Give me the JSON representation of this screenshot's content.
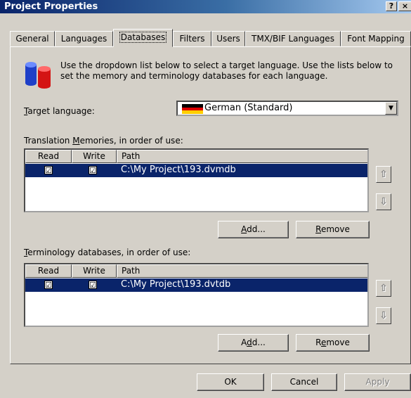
{
  "window": {
    "title": "Project Properties",
    "help_label": "?",
    "close_label": "×"
  },
  "tabs": [
    {
      "label": "General"
    },
    {
      "label": "Languages"
    },
    {
      "label": "Databases",
      "active": true
    },
    {
      "label": "Filters"
    },
    {
      "label": "Users"
    },
    {
      "label": "TMX/BIF Languages"
    },
    {
      "label": "Font Mapping"
    }
  ],
  "intro": "Use the dropdown list below to select a target language. Use the lists below to set the memory and terminology databases for each language.",
  "target_language": {
    "label_first": "T",
    "label_rest": "arget language:",
    "value": "German (Standard)",
    "flag_colors": [
      "#000000",
      "#dd0000",
      "#ffce00"
    ]
  },
  "tm": {
    "label_pre": "Translation ",
    "label_mnemonic": "M",
    "label_post": "emories, in order of use:",
    "columns": [
      "Read",
      "Write",
      "Path"
    ],
    "rows": [
      {
        "read": "☑",
        "write": "☑",
        "path": "C:\\My Project\\193.dvmdb"
      }
    ],
    "add_pre": "",
    "add_mnemonic": "A",
    "add_post": "dd...",
    "remove_pre": "",
    "remove_mnemonic": "R",
    "remove_post": "emove",
    "up_icon": "⇧",
    "down_icon": "⇩"
  },
  "term": {
    "label_mnemonic": "T",
    "label_post": "erminology databases, in order of use:",
    "columns": [
      "Read",
      "Write",
      "Path"
    ],
    "rows": [
      {
        "read": "☑",
        "write": "☑",
        "path": "C:\\My Project\\193.dvtdb"
      }
    ],
    "add_pre": "A",
    "add_mnemonic": "d",
    "add_post": "d...",
    "remove_pre": "R",
    "remove_mnemonic": "e",
    "remove_post": "move",
    "up_icon": "⇧",
    "down_icon": "⇩"
  },
  "footer": {
    "ok": "OK",
    "cancel": "Cancel",
    "apply": "Apply"
  },
  "colors": {
    "title_bar": "#0a246a",
    "selection": "#0a246a",
    "face": "#d4d0c8"
  }
}
